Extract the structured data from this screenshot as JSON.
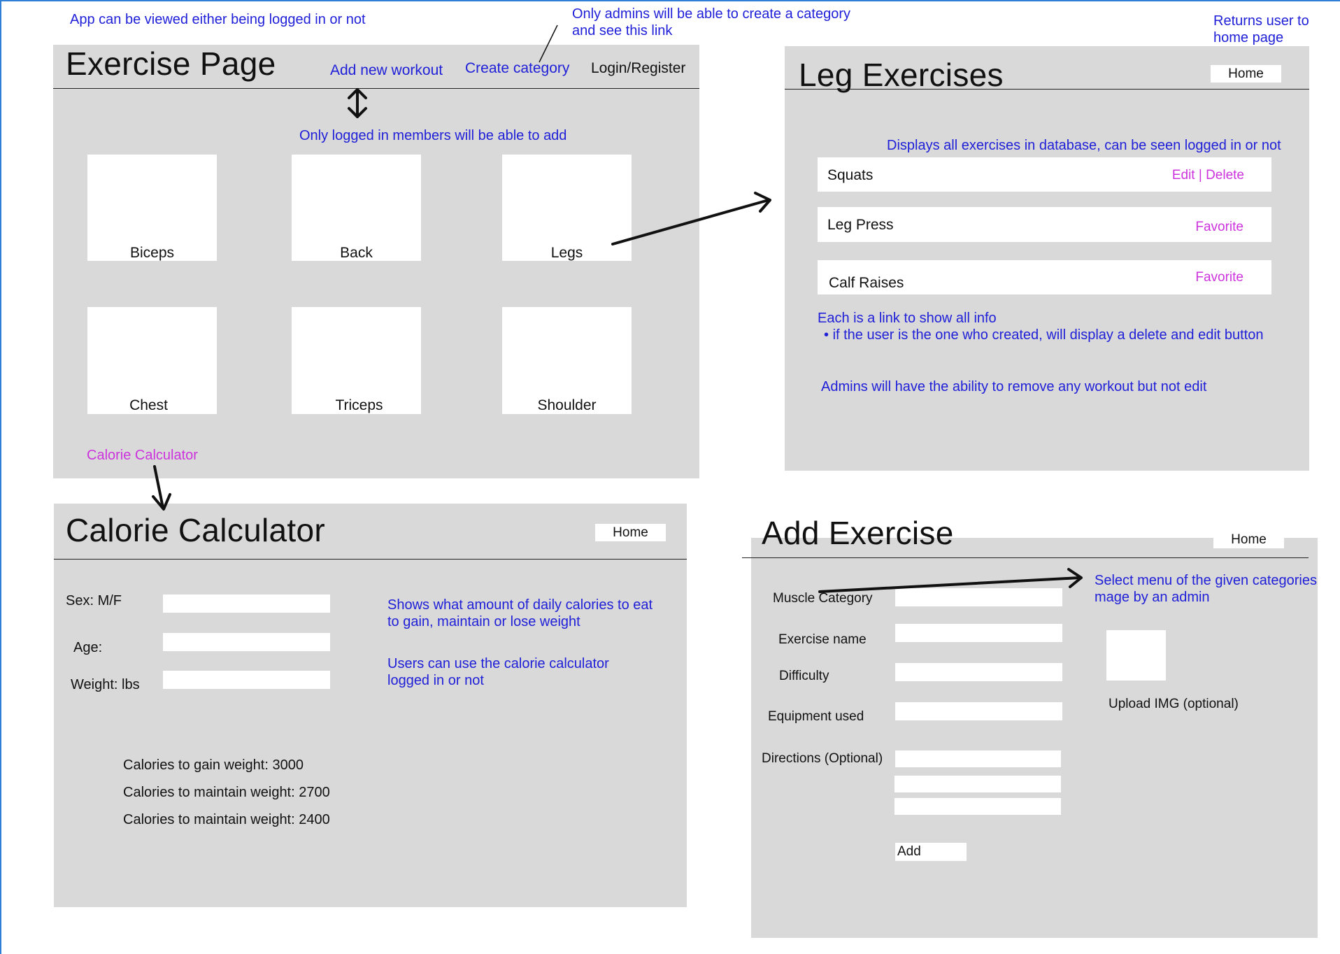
{
  "notes": {
    "top_left": "App can be viewed either being logged in or not",
    "admins_category": [
      "Only admins will be able to create a category",
      "and see this link"
    ],
    "returns_home": [
      "Returns user to",
      "home page"
    ],
    "members_add": "Only logged in members will be able to add",
    "displays_all": "Displays all exercises in database, can be seen logged in or not",
    "each_link": "Each is a link to show all info",
    "each_link_bullet": "if the user is the one who created, will display a delete and edit button",
    "admins_remove": "Admins will have the ability to remove any workout but not edit",
    "shows_calories": [
      "Shows what amount of daily calories to eat",
      "to gain, maintain or lose weight"
    ],
    "users_calculator": [
      "Users can use the calorie calculator",
      "logged in or not"
    ],
    "select_menu": [
      "Select menu of the given categories",
      "mage by an admin"
    ]
  },
  "exercise_page": {
    "title": "Exercise Page",
    "nav": {
      "add_workout": "Add new workout",
      "create_category": "Create category",
      "login": "Login/Register"
    },
    "tiles": [
      "Biceps",
      "Back",
      "Legs",
      "Chest",
      "Triceps",
      "Shoulder"
    ],
    "calorie_link": "Calorie Calculator"
  },
  "leg_exercises": {
    "title": "Leg Exercises",
    "home": "Home",
    "rows": [
      {
        "name": "Squats",
        "edit": "Edit",
        "sep": "|",
        "delete": "Delete"
      },
      {
        "name": "Leg Press",
        "action": "Favorite"
      },
      {
        "name": "Calf Raises",
        "action": "Favorite"
      }
    ]
  },
  "calorie_calculator": {
    "title": "Calorie Calculator",
    "home": "Home",
    "labels": {
      "sex": "Sex:  M/F",
      "age": "Age:",
      "weight": "Weight: lbs"
    },
    "results": [
      "Calories to gain weight: 3000",
      "Calories to maintain weight: 2700",
      "Calories to maintain weight: 2400"
    ]
  },
  "add_exercise": {
    "title": "Add Exercise",
    "home": "Home",
    "labels": {
      "category": "Muscle Category",
      "name": "Exercise name",
      "difficulty": "Difficulty",
      "equipment": "Equipment used",
      "directions": "Directions (Optional)"
    },
    "upload": "Upload IMG (optional)",
    "add": "Add"
  },
  "colors": {
    "annotation": "#2020d8",
    "link": "#cc33dd",
    "panel": "#d9d9d9"
  },
  "icons": [
    "double-arrow-icon",
    "arrow-icon"
  ]
}
